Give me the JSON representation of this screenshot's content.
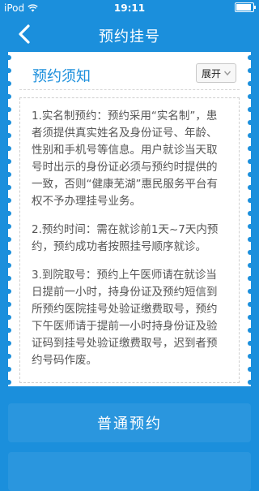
{
  "status_bar": {
    "carrier": "iPod",
    "time": "19:11"
  },
  "header": {
    "title": "预约挂号"
  },
  "notice": {
    "title": "预约须知",
    "expand_label": "展开",
    "paragraphs": [
      "1.实名制预约：预约采用“实名制”，患者须提供真实姓名及身份证号、年龄、性别和手机号等信息。用户就诊当天取号时出示的身份证必须与预约时提供的一致，否则“健康芜湖”惠民服务平台有权不予办理挂号业务。",
      "2.预约时间：需在就诊前1天~7天内预约，预约成功者按照挂号顺序就诊。",
      "3.到院取号：预约上午医师请在就诊当日提前一小时，持身份证及预约短信到所预约医院挂号处验证缴费取号，预约下午医师请于提前一小时持身份证及验证码到挂号处验证缴费取号，迟到者预约号码作废。"
    ]
  },
  "actions": {
    "normal_appointment": "普通预约"
  },
  "colors": {
    "brand": "#1b8fdc",
    "button": "#2a96de"
  }
}
